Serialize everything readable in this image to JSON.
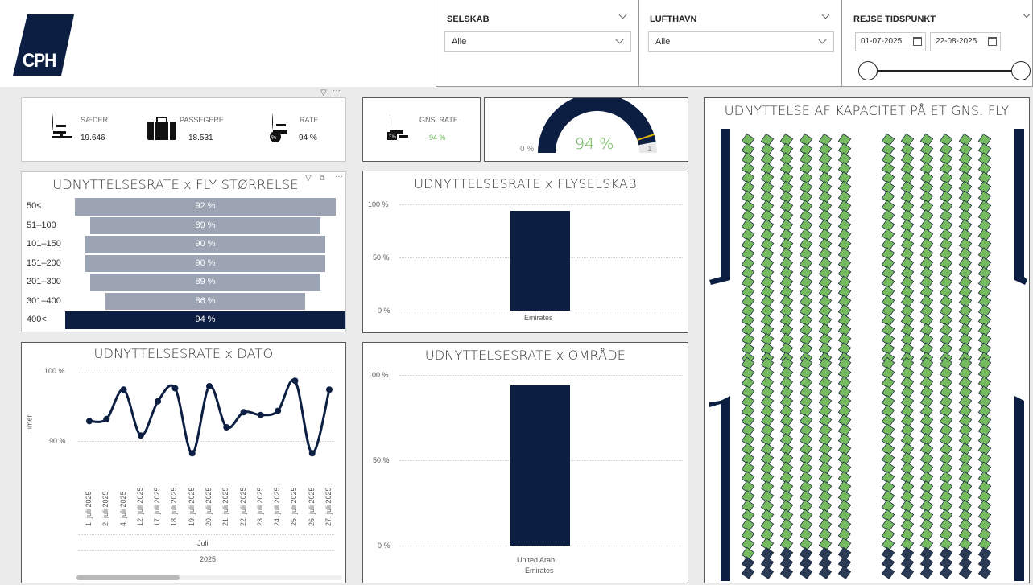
{
  "logo": {
    "text": "CPH"
  },
  "slicers": {
    "selskab": {
      "label": "SELSKAB",
      "value": "Alle"
    },
    "lufthavn": {
      "label": "LUFTHAVN",
      "value": "Alle"
    },
    "rejse": {
      "label": "REJSE TIDSPUNKT",
      "from": "01-07-2025",
      "to": "22-08-2025"
    }
  },
  "kpis": {
    "saeder": {
      "label": "SÆDER",
      "value": "19.646"
    },
    "passagere": {
      "label": "PASSEGERE",
      "value": "18.531"
    },
    "rate": {
      "label": "RATE",
      "value": "94 %"
    },
    "gns_rate": {
      "label": "GNS. RATE",
      "value": "94 %"
    }
  },
  "gauge": {
    "value": "94 %",
    "min": "0 %",
    "max": "1",
    "fraction": 0.94
  },
  "size_chart": {
    "title": "UDNYTTELSESRATE x FLY STØRRELSE",
    "rows": [
      {
        "label": "50≤",
        "value": "92 %",
        "pct": 92
      },
      {
        "label": "51–100",
        "value": "89 %",
        "pct": 89
      },
      {
        "label": "101–150",
        "value": "90 %",
        "pct": 90
      },
      {
        "label": "151–200",
        "value": "90 %",
        "pct": 90
      },
      {
        "label": "201–300",
        "value": "89 %",
        "pct": 89
      },
      {
        "label": "301–400",
        "value": "86 %",
        "pct": 86
      },
      {
        "label": "400<",
        "value": "94 %",
        "pct": 94
      }
    ]
  },
  "airline_chart": {
    "title": "UDNYTTELSESRATE x FLYSELSKAB",
    "ticks": [
      "100 %",
      "50 %",
      "0 %"
    ],
    "bars": [
      {
        "label": "Emirates",
        "value": 94
      }
    ]
  },
  "date_chart": {
    "title": "UDNYTTELSESRATE x DATO",
    "ylabel": "Timer",
    "ticks": [
      "100 %",
      "90 %"
    ],
    "month": "Juli",
    "year": "2025",
    "dates": [
      "1. juli 2025",
      "2. juli 2025",
      "4. juli 2025",
      "12. juli 2025",
      "17. juli 2025",
      "18. juli 2025",
      "19. juli 2025",
      "20. juli 2025",
      "21. juli 2025",
      "22. juli 2025",
      "23. juli 2025",
      "24. juli 2025",
      "25. juli 2025",
      "26. juli 2025",
      "27. juli 2025"
    ]
  },
  "area_chart": {
    "title": "UDNYTTELSESRATE x OMRÅDE",
    "ticks": [
      "100 %",
      "50 %",
      "0 %"
    ],
    "bars": [
      {
        "label1": "United Arab",
        "label2": "Emirates",
        "value": 94
      }
    ]
  },
  "seat_map": {
    "title": "UDNYTTELSE AF KAPACITET PÅ ET GNS. FLY"
  },
  "chart_data": [
    {
      "type": "bar",
      "title": "UDNYTTELSESRATE x FLY STØRRELSE",
      "categories": [
        "50≤",
        "51–100",
        "101–150",
        "151–200",
        "201–300",
        "301–400",
        "400<"
      ],
      "values": [
        92,
        89,
        90,
        90,
        89,
        86,
        94
      ]
    },
    {
      "type": "bar",
      "title": "UDNYTTELSESRATE x FLYSELSKAB",
      "categories": [
        "Emirates"
      ],
      "values": [
        94
      ],
      "ylim": [
        0,
        100
      ]
    },
    {
      "type": "line",
      "title": "UDNYTTELSESRATE x DATO",
      "ylabel": "Timer",
      "x": [
        "1. juli 2025",
        "2. juli 2025",
        "4. juli 2025",
        "12. juli 2025",
        "17. juli 2025",
        "18. juli 2025",
        "19. juli 2025",
        "20. juli 2025",
        "21. juli 2025",
        "22. juli 2025",
        "23. juli 2025",
        "24. juli 2025",
        "25. juli 2025",
        "26. juli 2025",
        "27. juli 2025"
      ],
      "y": [
        92.9,
        93.2,
        97.5,
        90.8,
        95.8,
        97.7,
        88.2,
        98.0,
        92.0,
        94.2,
        93.8,
        94.4,
        98.8,
        88.2,
        97.5
      ]
    },
    {
      "type": "bar",
      "title": "UDNYTTELSESRATE x OMRÅDE",
      "categories": [
        "United Arab Emirates"
      ],
      "values": [
        94
      ],
      "ylim": [
        0,
        100
      ]
    }
  ],
  "colors": {
    "navy": "#0c1f43",
    "gray_bar": "#9ca3b2",
    "green": "#77bb60",
    "seat_dark": "#2b3a55",
    "gauge_accent": "#e6b800"
  }
}
